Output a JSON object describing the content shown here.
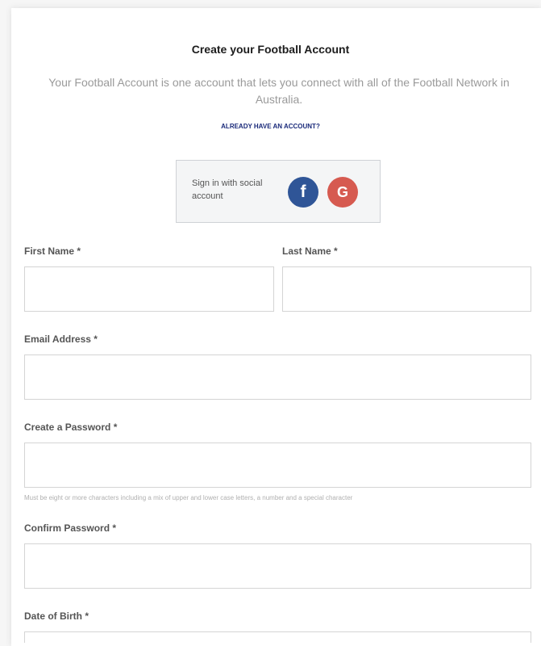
{
  "header": {
    "title": "Create your Football Account",
    "subtitle": "Your Football Account is one account that lets you connect with all of the Football Network in Australia.",
    "already_link": "ALREADY HAVE AN ACCOUNT?"
  },
  "social": {
    "text": "Sign in with social account",
    "facebook_icon": "f",
    "google_icon": "G",
    "colors": {
      "facebook": "#2f5597",
      "google": "#d65a50"
    }
  },
  "form": {
    "first_name_label": "First Name *",
    "last_name_label": "Last Name *",
    "email_label": "Email Address *",
    "password_label": "Create a Password *",
    "password_hint": "Must be eight or more characters including a mix of upper and lower case letters, a number and a special character",
    "confirm_label": "Confirm Password *",
    "dob_label": "Date of Birth *"
  }
}
